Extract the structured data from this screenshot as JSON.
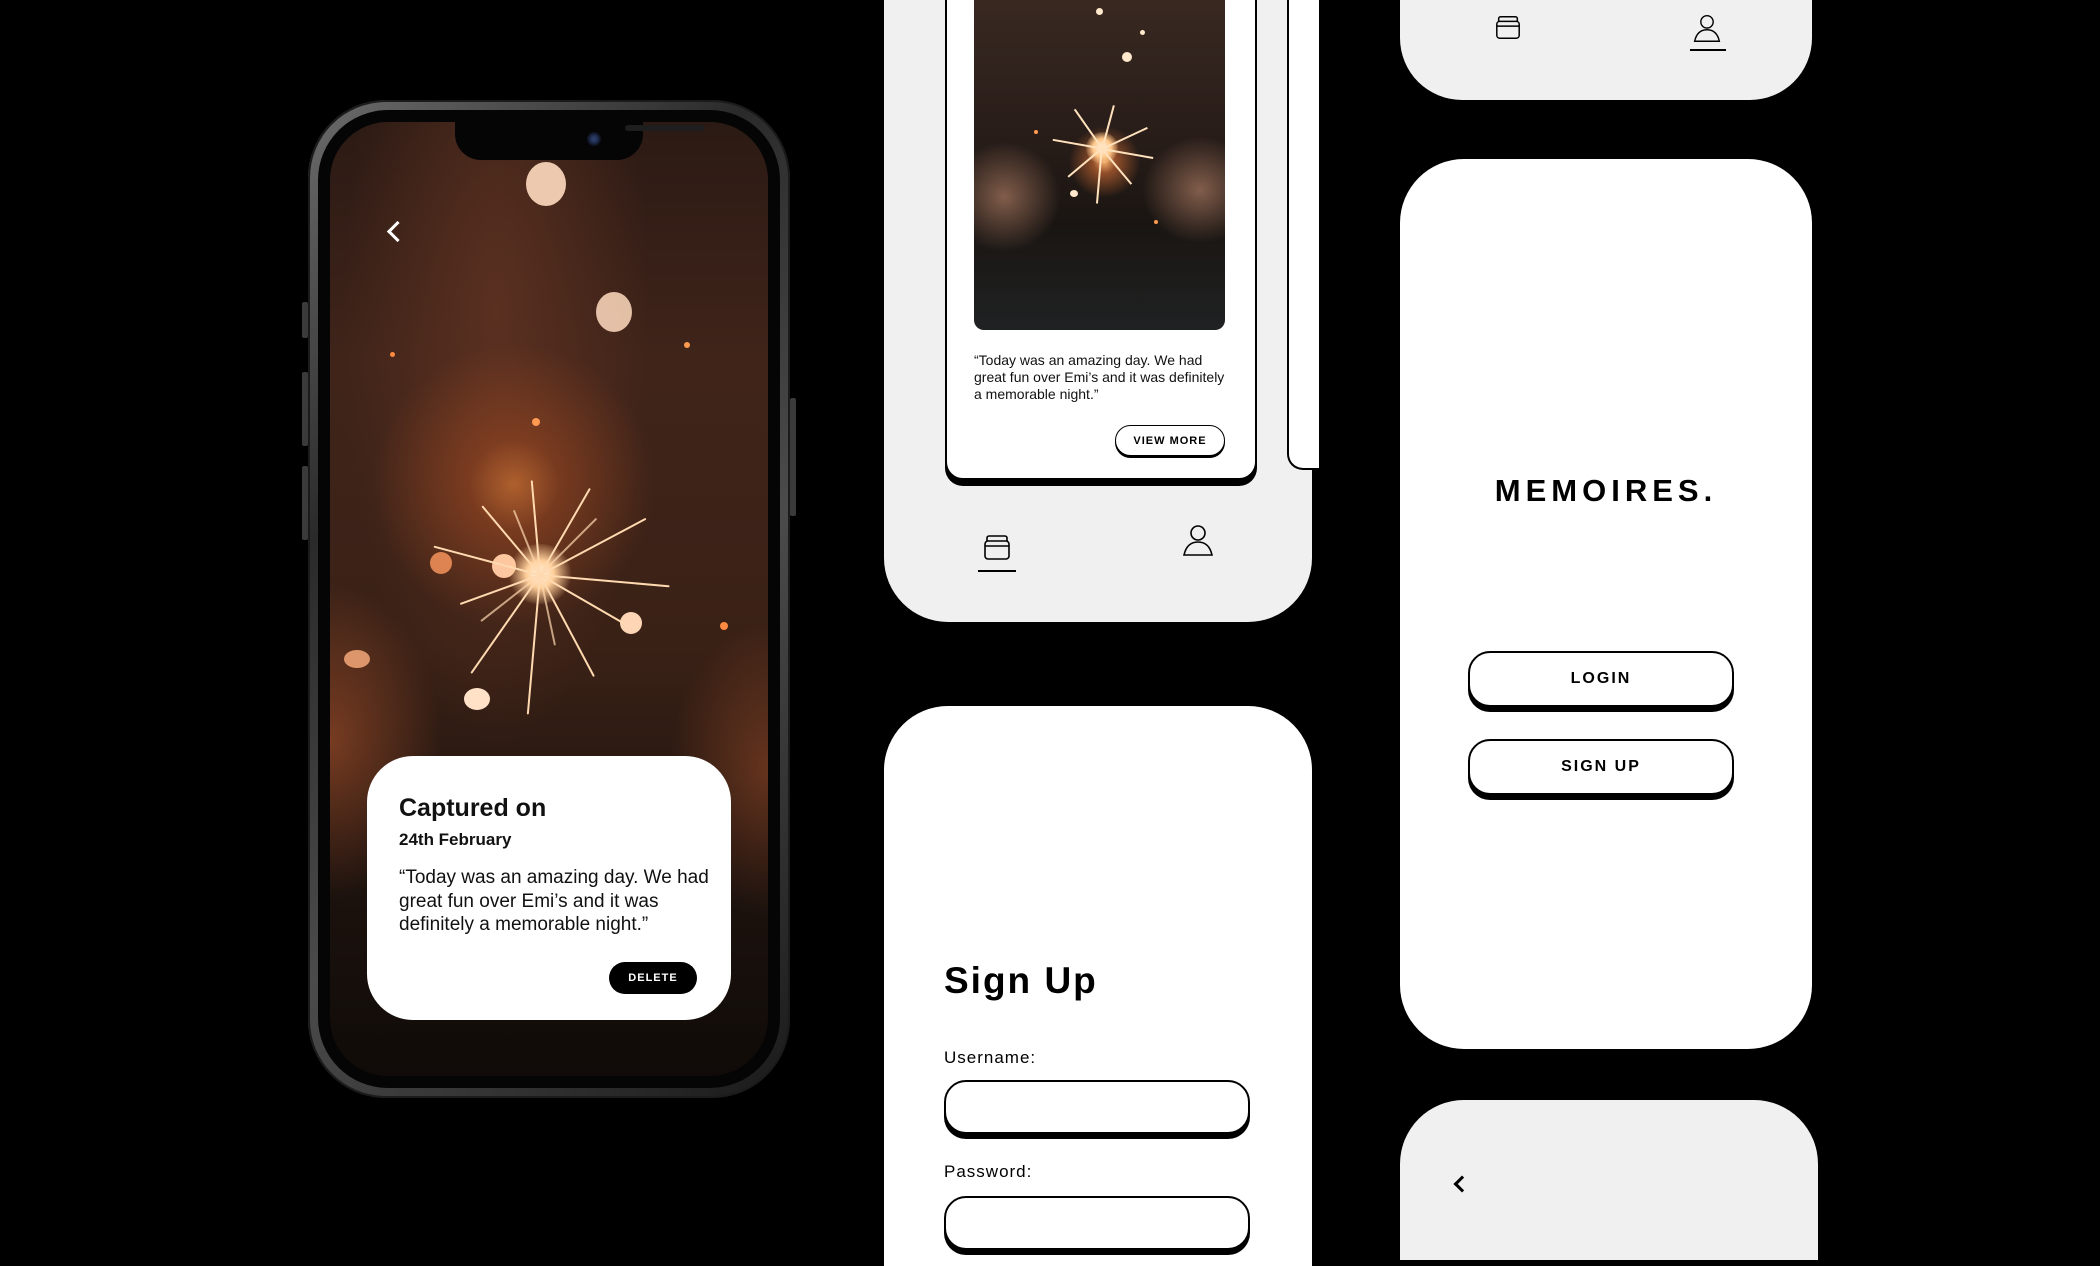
{
  "memory_detail": {
    "title": "Captured on",
    "date": "24th February",
    "quote": "“Today was an amazing day. We had great fun over Emi’s and it was definitely a memorable night.”",
    "delete_label": "DELETE"
  },
  "feed": {
    "quote": "“Today was an amazing day. We had great fun over Emi’s and it was definitely a memorable night.”",
    "view_more_label": "VIEW MORE",
    "nav": [
      "memories-icon",
      "profile-icon"
    ]
  },
  "landing": {
    "logo": "MEMOIRES.",
    "login_label": "LOGIN",
    "signup_label": "SIGN UP"
  },
  "signup": {
    "title": "Sign Up",
    "username_label": "Username:",
    "username_value": "",
    "password_label": "Password:"
  },
  "colors": {
    "background": "#000000",
    "panel": "#ffffff",
    "panel_gray": "#f0f0f0",
    "accent": "#000000"
  }
}
